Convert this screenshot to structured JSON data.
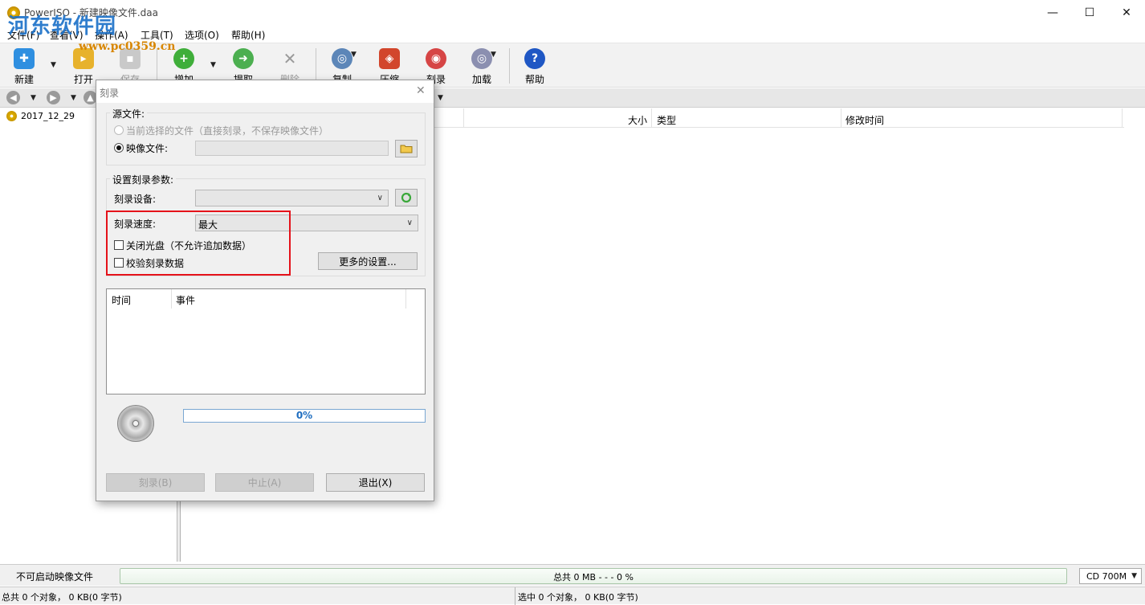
{
  "window": {
    "title": "PowerISO - 新建映像文件.daa",
    "watermark": "河东软件园",
    "watermark_url": "www.pc0359.cn",
    "controls": {
      "minimize": "—",
      "maximize": "☐",
      "close": "✕"
    }
  },
  "menu": [
    "文件(F)",
    "查看(V)",
    "操作(A)",
    "工具(T)",
    "选项(O)",
    "帮助(H)"
  ],
  "toolbar": {
    "new": "新建",
    "open": "打开",
    "save": "保存",
    "add": "增加",
    "extract": "提取",
    "delete": "删除",
    "copy": "复制",
    "compress": "压缩",
    "burn": "刻录",
    "mount": "加载",
    "help": "帮助"
  },
  "tree": {
    "node": "2017_12_29"
  },
  "columns": {
    "size": "大小",
    "type": "类型",
    "modified": "修改时间"
  },
  "status": {
    "boot": "不可启动映像文件",
    "total_usage": "总共 0 MB   - - -  0 %",
    "usage_fraction": 0,
    "disk_type": "CD 700M",
    "total_objects": "总共 0 个对象， 0 KB(0 字节)",
    "selected_objects": "选中 0 个对象， 0 KB(0 字节)"
  },
  "dialog": {
    "title": "刻录",
    "source": {
      "legend": "源文件:",
      "option_current": "当前选择的文件（直接刻录，不保存映像文件）",
      "option_image": "映像文件:",
      "image_path": ""
    },
    "params": {
      "legend": "设置刻录参数:",
      "device_label": "刻录设备:",
      "device_value": "",
      "speed_label": "刻录速度:",
      "speed_value": "最大",
      "close_disc": "关闭光盘（不允许追加数据）",
      "verify": "校验刻录数据",
      "more_settings": "更多的设置..."
    },
    "log": {
      "col_time": "时间",
      "col_event": "事件",
      "rows": []
    },
    "progress": {
      "text": "0%",
      "fraction": 0
    },
    "buttons": {
      "burn": "刻录(B)",
      "abort": "中止(A)",
      "exit": "退出(X)"
    }
  }
}
